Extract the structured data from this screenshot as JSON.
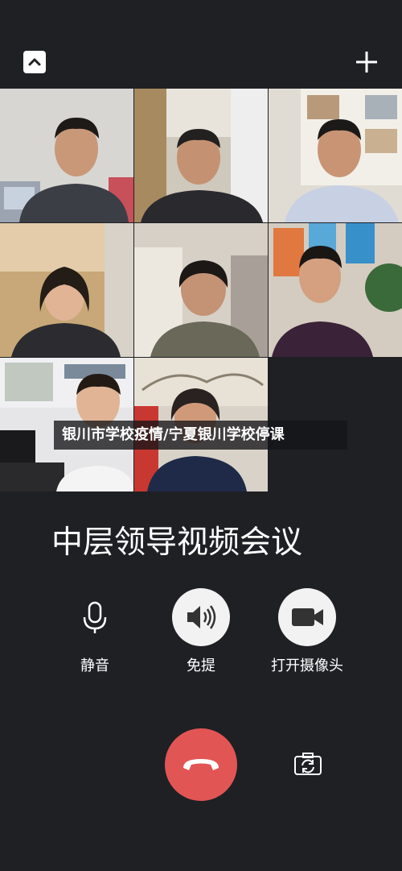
{
  "caption": "银川市学校疫情/宁夏银川学校停课",
  "meeting": {
    "title": "中层领导视频会议"
  },
  "controls": {
    "mute_label": "静音",
    "speaker_label": "免提",
    "camera_label": "打开摄像头"
  },
  "icons": {
    "collapse": "chevron-up-icon",
    "add": "plus-icon",
    "mute": "microphone-icon",
    "speaker": "speaker-icon",
    "camera": "video-camera-icon",
    "hangup": "phone-hangup-icon",
    "switch_camera": "camera-switch-icon"
  },
  "colors": {
    "background": "#1f2024",
    "hangup": "#e25555",
    "button_light": "#f2f2f2"
  },
  "participants_count": 8
}
